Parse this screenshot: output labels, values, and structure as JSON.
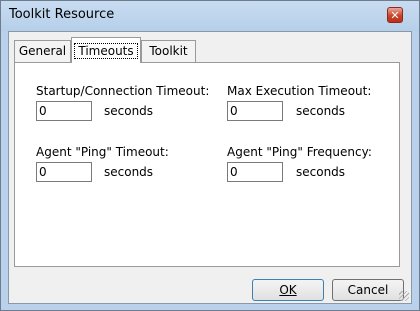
{
  "window": {
    "title": "Toolkit Resource",
    "close_glyph": "✕"
  },
  "tabs": [
    {
      "label": "General",
      "active": false
    },
    {
      "label": "Timeouts",
      "active": true
    },
    {
      "label": "Toolkit",
      "active": false
    }
  ],
  "fields": {
    "startup": {
      "label": "Startup/Connection Timeout:",
      "value": "0",
      "unit": "seconds"
    },
    "max_exec": {
      "label": "Max Execution Timeout:",
      "value": "0",
      "unit": "seconds"
    },
    "ping_timeout": {
      "label": "Agent \"Ping\" Timeout:",
      "value": "0",
      "unit": "seconds"
    },
    "ping_freq": {
      "label": "Agent \"Ping\" Frequency:",
      "value": "0",
      "unit": "seconds"
    }
  },
  "buttons": {
    "ok": "OK",
    "cancel": "Cancel"
  },
  "colors": {
    "title_bar": "#b9d1ea",
    "close_button": "#c9432b",
    "dialog_bg": "#f0f0f0"
  }
}
